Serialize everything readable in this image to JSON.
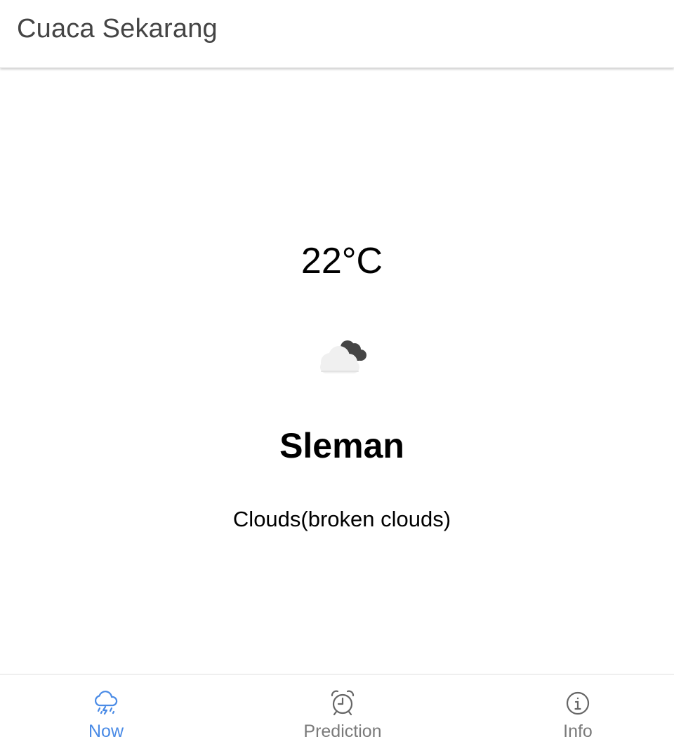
{
  "header": {
    "title": "Cuaca Sekarang"
  },
  "weather": {
    "temperature": "22°C",
    "icon": "broken-clouds-icon",
    "city": "Sleman",
    "condition": "Clouds(broken clouds)"
  },
  "tabs": [
    {
      "label": "Now",
      "icon": "cloud-rain-lightning-icon",
      "active": true
    },
    {
      "label": "Prediction",
      "icon": "alarm-clock-icon",
      "active": false
    },
    {
      "label": "Info",
      "icon": "info-circle-icon",
      "active": false
    }
  ],
  "colors": {
    "accent": "#4a8be6",
    "inactive": "#7a7a7a",
    "title": "#444444"
  }
}
